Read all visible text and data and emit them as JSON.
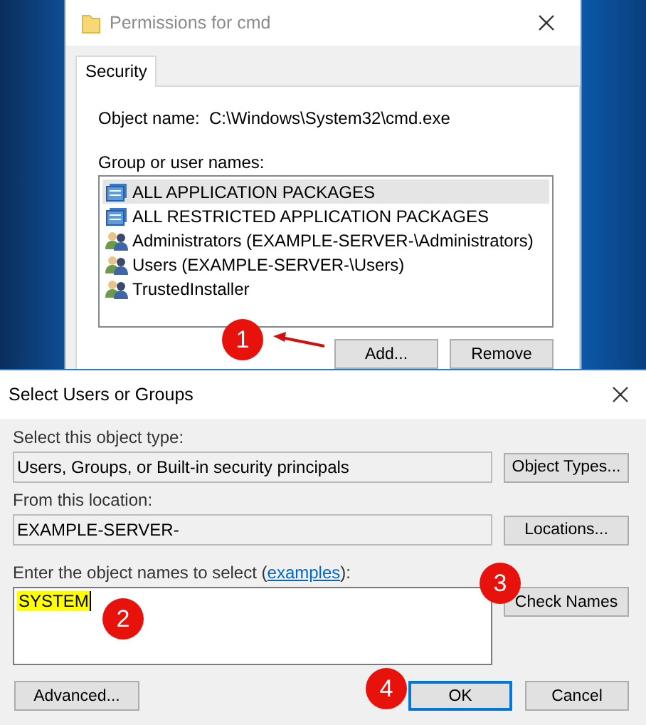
{
  "back_dialog": {
    "title": "Permissions for cmd",
    "tabs": [
      {
        "label": "Security",
        "selected": true
      }
    ],
    "object_name_label": "Object name:",
    "object_name": "C:\\Windows\\System32\\cmd.exe",
    "group_label": "Group or user names:",
    "groups": [
      {
        "name": "ALL APPLICATION PACKAGES",
        "kind": "package",
        "selected": true
      },
      {
        "name": "ALL RESTRICTED APPLICATION PACKAGES",
        "kind": "package",
        "selected": false
      },
      {
        "name": "Administrators (EXAMPLE-SERVER-\\Administrators)",
        "kind": "users",
        "selected": false
      },
      {
        "name": "Users (EXAMPLE-SERVER-\\Users)",
        "kind": "users",
        "selected": false
      },
      {
        "name": "TrustedInstaller",
        "kind": "users",
        "selected": false
      }
    ],
    "buttons": [
      "Add...",
      "Remove"
    ]
  },
  "dialog": {
    "title": "Select Users or Groups",
    "object_type_label": "Select this object type:",
    "object_type": "Users, Groups, or Built-in security principals",
    "object_types_button": "Object Types...",
    "location_label": "From this location:",
    "location": "EXAMPLE-SERVER-",
    "locations_button": "Locations...",
    "names_label": "Enter the object names to select (",
    "names_link": "examples",
    "names_label_end": "):",
    "names_value": "SYSTEM",
    "names_highlighted": true,
    "check_names_button": "Check Names",
    "advanced_button": "Advanced...",
    "ok_button": {
      "label": "OK",
      "default": true
    },
    "cancel_button": "Cancel"
  },
  "callouts": [
    {
      "number": "1"
    },
    {
      "number": "2"
    },
    {
      "number": "3"
    },
    {
      "number": "4"
    }
  ]
}
